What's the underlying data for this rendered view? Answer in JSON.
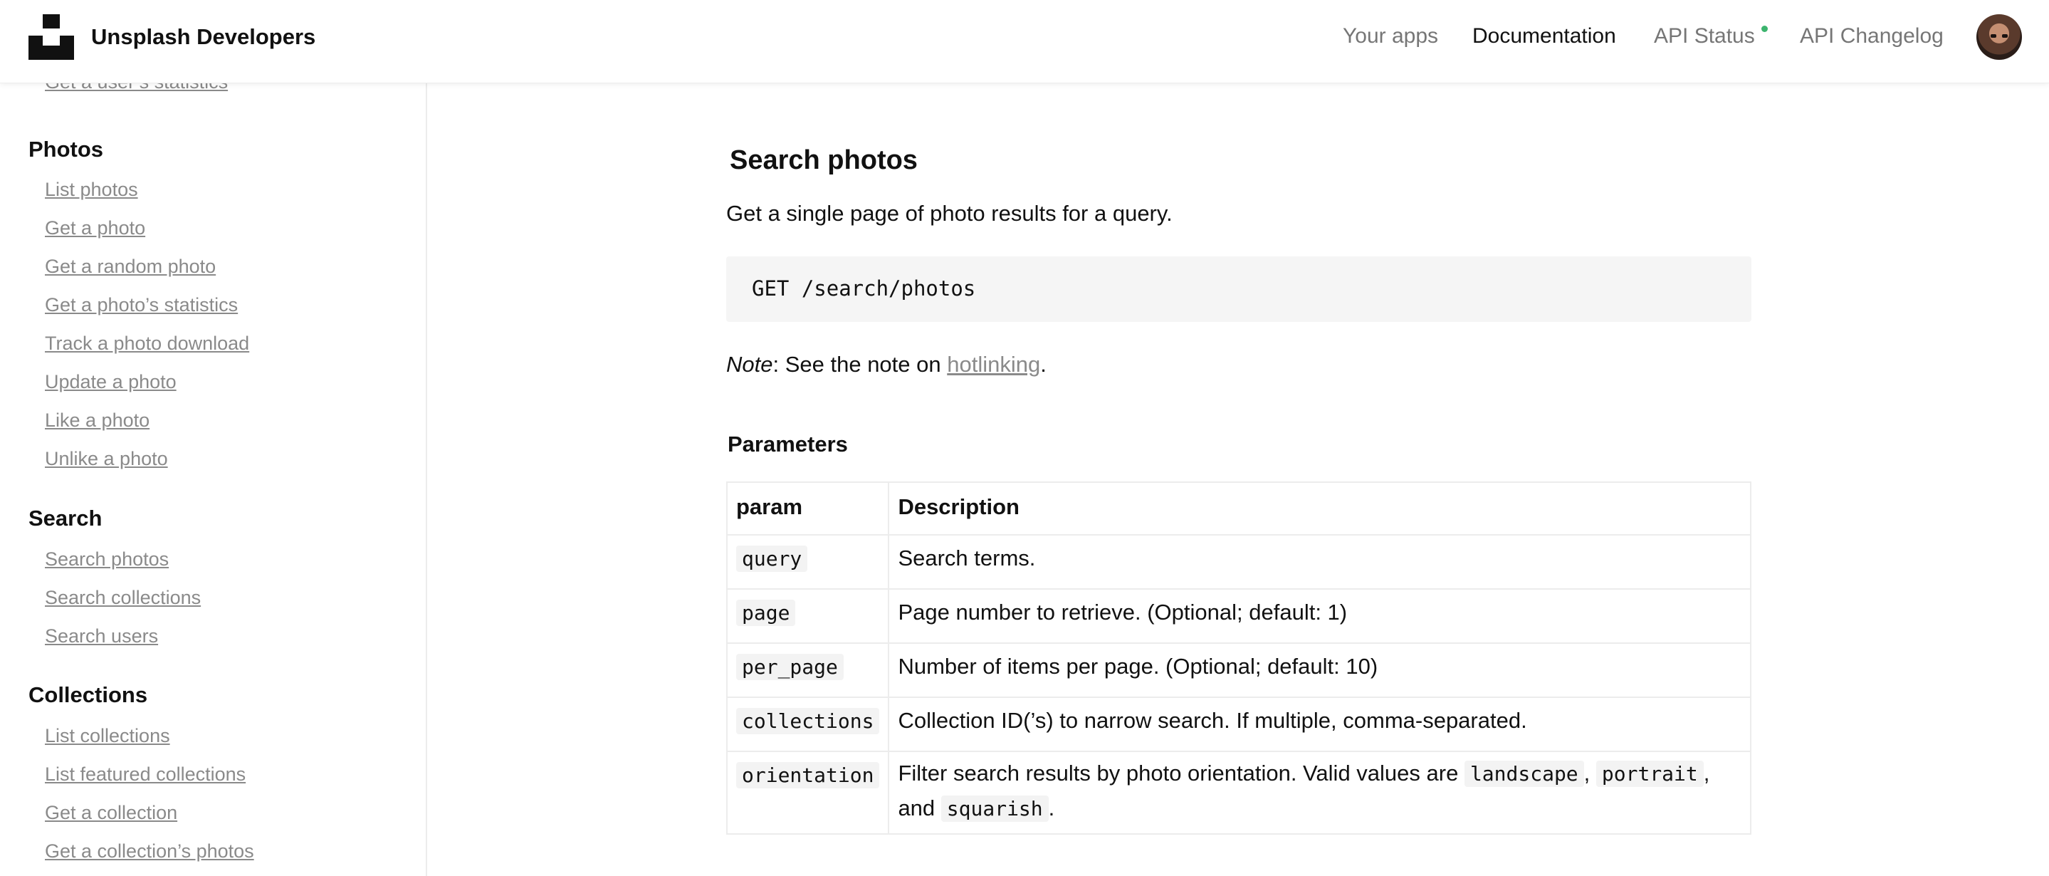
{
  "header": {
    "brand": "Unsplash Developers",
    "nav": [
      {
        "label": "Your apps",
        "active": false
      },
      {
        "label": "Documentation",
        "active": true
      },
      {
        "label": "API Status",
        "active": false,
        "status_color": "#3cb46e"
      },
      {
        "label": "API Changelog",
        "active": false
      }
    ]
  },
  "sidebar": {
    "partial_link": "Get a user’s statistics",
    "sections": [
      {
        "title": "Photos",
        "links": [
          "List photos",
          "Get a photo",
          "Get a random photo",
          "Get a photo’s statistics",
          "Track a photo download",
          "Update a photo",
          "Like a photo",
          "Unlike a photo"
        ]
      },
      {
        "title": "Search",
        "links": [
          "Search photos",
          "Search collections",
          "Search users"
        ]
      },
      {
        "title": "Collections",
        "links": [
          "List collections",
          "List featured collections",
          "Get a collection",
          "Get a collection’s photos"
        ]
      }
    ]
  },
  "main": {
    "title": "Search photos",
    "lead": "Get a single page of photo results for a query.",
    "endpoint": "GET /search/photos",
    "note": {
      "label": "Note",
      "text": ": See the note on ",
      "link": "hotlinking",
      "end": "."
    },
    "params_title": "Parameters",
    "table": {
      "headers": [
        "param",
        "Description"
      ],
      "rows": [
        {
          "param": "query",
          "desc": "Search terms."
        },
        {
          "param": "page",
          "desc": "Page number to retrieve. (Optional; default: 1)"
        },
        {
          "param": "per_page",
          "desc": "Number of items per page. (Optional; default: 10)"
        },
        {
          "param": "collections",
          "desc": "Collection ID(’s) to narrow search. If multiple, comma-separated."
        },
        {
          "param": "orientation",
          "desc_prefix": "Filter search results by photo orientation. Valid values are ",
          "values": [
            "landscape",
            "portrait",
            "squarish"
          ],
          "sep": ", ",
          "and": ", and ",
          "end": "."
        }
      ]
    }
  }
}
